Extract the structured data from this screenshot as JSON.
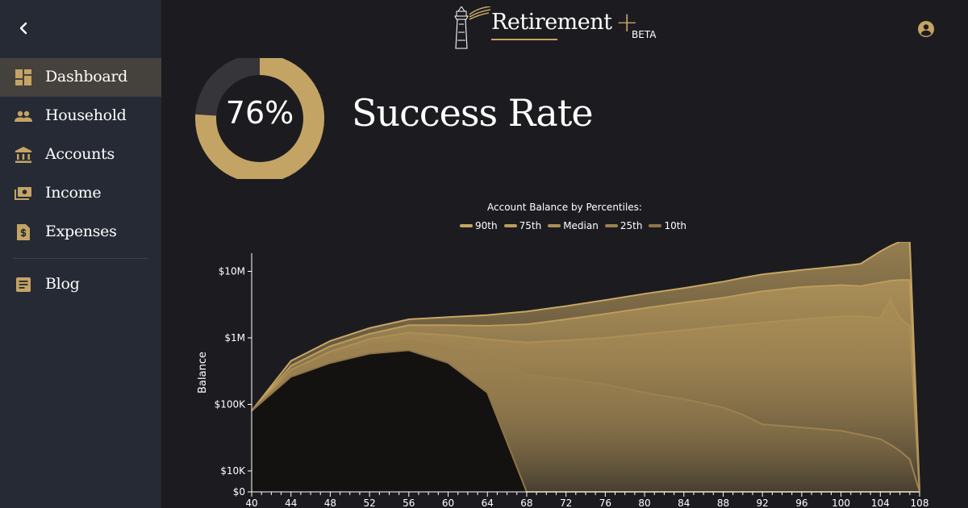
{
  "sidebar": {
    "items": [
      {
        "label": "Dashboard",
        "icon": "dashboard-icon",
        "active": true
      },
      {
        "label": "Household",
        "icon": "people-icon"
      },
      {
        "label": "Accounts",
        "icon": "bank-icon"
      },
      {
        "label": "Income",
        "icon": "cash-icon"
      },
      {
        "label": "Expenses",
        "icon": "receipt-dollar-icon"
      },
      {
        "label": "Blog",
        "icon": "article-icon"
      }
    ]
  },
  "header": {
    "brand": "Retirement",
    "brand_plus": "+",
    "badge": "BETA"
  },
  "summary": {
    "success_rate": "76%",
    "success_rate_value": 0.76,
    "title": "Success Rate"
  },
  "colors": {
    "accent": "#c4a464",
    "sidebar_bg": "#262a35",
    "page_bg": "#1c1c20",
    "active_item_bg": "#45413d"
  },
  "chart_data": {
    "type": "area",
    "title": "Account Balance by Percentiles:",
    "ylabel": "Balance",
    "xlabel": "",
    "legend_position": "top",
    "y_scale": "log",
    "y_ticks": [
      "$0",
      "$10K",
      "$100K",
      "$1M",
      "$10M"
    ],
    "x_ticks": [
      "40",
      "44",
      "48",
      "52",
      "56",
      "60",
      "64",
      "68",
      "72",
      "76",
      "80",
      "84",
      "88",
      "92",
      "96",
      "100",
      "104",
      "108"
    ],
    "x": [
      40,
      44,
      48,
      52,
      56,
      60,
      64,
      68,
      72,
      76,
      80,
      84,
      88,
      90,
      92,
      96,
      100,
      102,
      104,
      105,
      106,
      107,
      108
    ],
    "series": [
      {
        "name": "90th",
        "color": "#c7a664",
        "values": [
          80000,
          450000,
          900000,
          1400000,
          1900000,
          2050000,
          2200000,
          2500000,
          3000000,
          3700000,
          4600000,
          5600000,
          7000000,
          8000000,
          9000000,
          10500000,
          12000000,
          13000000,
          20000000,
          24000000,
          28000000,
          28000000,
          0
        ]
      },
      {
        "name": "75th",
        "color": "#bb9c5d",
        "values": [
          80000,
          380000,
          750000,
          1150000,
          1550000,
          1550000,
          1520000,
          1600000,
          1900000,
          2300000,
          2800000,
          3400000,
          4000000,
          4500000,
          5000000,
          5800000,
          6200000,
          6000000,
          6800000,
          7200000,
          7400000,
          7400000,
          0
        ]
      },
      {
        "name": "Median",
        "color": "#ad8f56",
        "values": [
          80000,
          330000,
          620000,
          960000,
          1200000,
          1100000,
          950000,
          850000,
          920000,
          1000000,
          1150000,
          1300000,
          1500000,
          1600000,
          1700000,
          1900000,
          2100000,
          2100000,
          2000000,
          3800000,
          2000000,
          1500000,
          0
        ]
      },
      {
        "name": "25th",
        "color": "#9c8150",
        "values": [
          80000,
          290000,
          520000,
          750000,
          900000,
          720000,
          530000,
          280000,
          240000,
          200000,
          150000,
          120000,
          90000,
          70000,
          50000,
          45000,
          40000,
          35000,
          30000,
          25000,
          20000,
          15000,
          0
        ]
      },
      {
        "name": "10th",
        "color": "#8e7548",
        "values": [
          80000,
          260000,
          420000,
          580000,
          650000,
          420000,
          150000,
          0,
          0,
          0,
          0,
          0,
          0,
          0,
          0,
          0,
          0,
          0,
          0,
          0,
          0,
          0,
          0
        ]
      }
    ]
  }
}
